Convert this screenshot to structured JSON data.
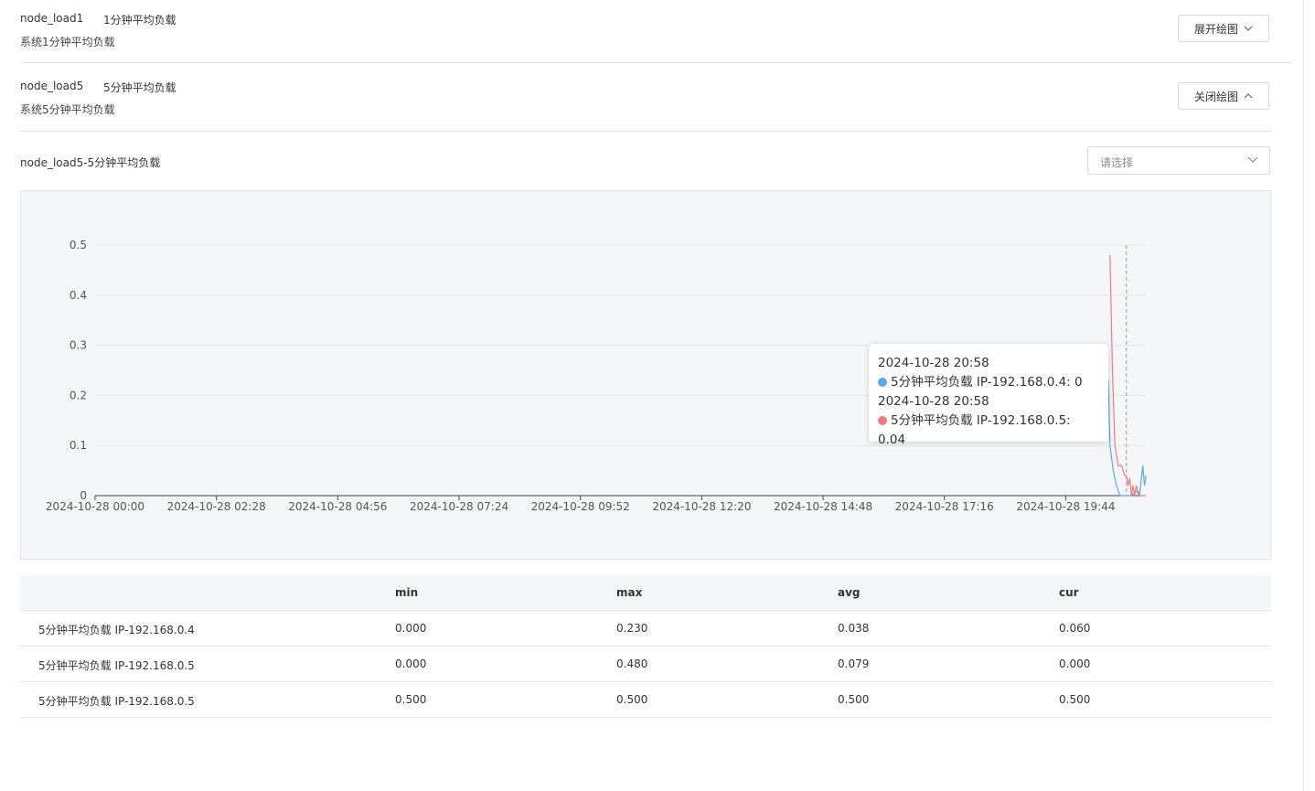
{
  "metrics": [
    {
      "name": "node_load1",
      "title": "1分钟平均负载",
      "desc": "系统1分钟平均负载",
      "button": "展开绘图",
      "expanded": false
    },
    {
      "name": "node_load5",
      "title": "5分钟平均负载",
      "desc": "系统5分钟平均负载",
      "button": "关闭绘图",
      "expanded": true
    }
  ],
  "chart_panel": {
    "title": "node_load5-5分钟平均负载",
    "select_placeholder": "请选择"
  },
  "chart_data": {
    "type": "line",
    "ylim": [
      0,
      0.5
    ],
    "yticks": [
      "0",
      "0.1",
      "0.2",
      "0.3",
      "0.4",
      "0.5"
    ],
    "xticks": [
      "2024-10-28 00:00",
      "2024-10-28 02:28",
      "2024-10-28 04:56",
      "2024-10-28 07:24",
      "2024-10-28 09:52",
      "2024-10-28 12:20",
      "2024-10-28 14:48",
      "2024-10-28 17:16",
      "2024-10-28 19:44"
    ],
    "grid": true,
    "series": [
      {
        "name": "5分钟平均负载 IP-192.168.0.4",
        "color": "#5aa9e8",
        "points": [
          [
            "2024-10-28 20:36",
            0.23
          ],
          [
            "2024-10-28 20:38",
            0.1
          ],
          [
            "2024-10-28 20:42",
            0.05
          ],
          [
            "2024-10-28 20:46",
            0.02
          ],
          [
            "2024-10-28 20:50",
            0.0
          ],
          [
            "2024-10-28 20:58",
            0.0
          ],
          [
            "2024-10-28 21:04",
            0.0
          ],
          [
            "2024-10-28 21:10",
            0.01
          ],
          [
            "2024-10-28 21:14",
            0.0
          ],
          [
            "2024-10-28 21:18",
            0.06
          ],
          [
            "2024-10-28 21:20",
            0.02
          ],
          [
            "2024-10-28 21:22",
            0.04
          ]
        ]
      },
      {
        "name": "5分钟平均负载 IP-192.168.0.5",
        "color": "#f07b7b",
        "points": [
          [
            "2024-10-28 20:38",
            0.48
          ],
          [
            "2024-10-28 20:41",
            0.25
          ],
          [
            "2024-10-28 20:44",
            0.1
          ],
          [
            "2024-10-28 20:48",
            0.06
          ],
          [
            "2024-10-28 20:52",
            0.06
          ],
          [
            "2024-10-28 20:56",
            0.04
          ],
          [
            "2024-10-28 20:58",
            0.04
          ],
          [
            "2024-10-28 21:00",
            0.02
          ],
          [
            "2024-10-28 21:02",
            0.035
          ],
          [
            "2024-10-28 21:04",
            0.0
          ],
          [
            "2024-10-28 21:06",
            0.02
          ],
          [
            "2024-10-28 21:08",
            0.0
          ],
          [
            "2024-10-28 21:10",
            0.02
          ],
          [
            "2024-10-28 21:14",
            0.0
          ],
          [
            "2024-10-28 21:22",
            0.0
          ]
        ]
      }
    ],
    "hover_time": "2024-10-28 20:58"
  },
  "tooltip": {
    "entries": [
      {
        "time": "2024-10-28 20:58",
        "label": "5分钟平均负载 IP-192.168.0.4: 0",
        "color": "#5aa9e8"
      },
      {
        "time": "2024-10-28 20:58",
        "label": "5分钟平均负载 IP-192.168.0.5: 0.04",
        "color": "#f07b7b"
      }
    ]
  },
  "stats_table": {
    "columns": [
      "",
      "min",
      "max",
      "avg",
      "cur"
    ],
    "rows": [
      [
        "5分钟平均负载 IP-192.168.0.4",
        "0.000",
        "0.230",
        "0.038",
        "0.060"
      ],
      [
        "5分钟平均负载 IP-192.168.0.5",
        "0.000",
        "0.480",
        "0.079",
        "0.000"
      ],
      [
        "5分钟平均负载 IP-192.168.0.5",
        "0.500",
        "0.500",
        "0.500",
        "0.500"
      ]
    ]
  }
}
